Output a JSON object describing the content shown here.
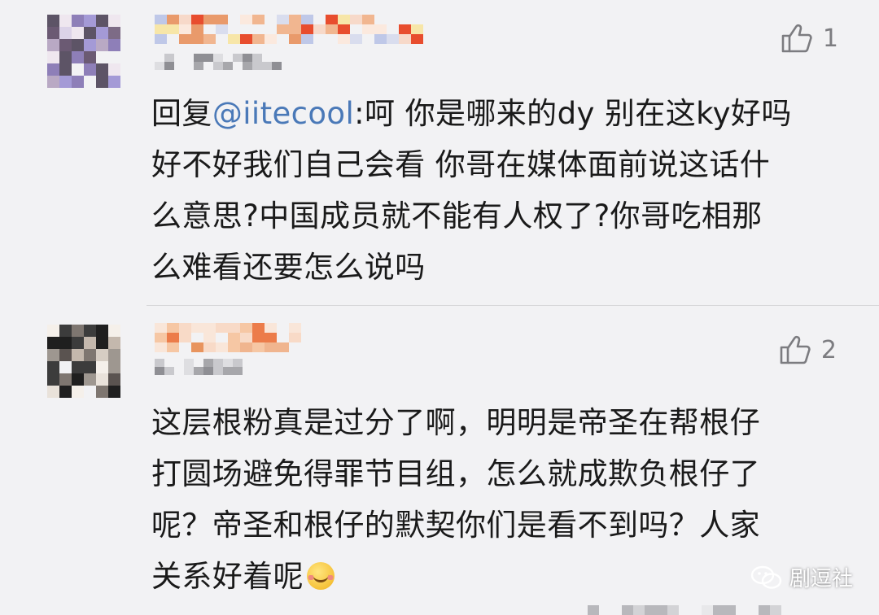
{
  "comments": [
    {
      "likes": "1",
      "mention": "@iitecool",
      "reply_prefix": "回复",
      "reply_rest": ":呵 你是哪来的dy 别在这ky好吗\n好不好我们自己会看 你哥在媒体面前说这话什\n么意思?中国成员就不能有人权了?你哥吃相那\n么难看还要怎么说吗"
    },
    {
      "likes": "2",
      "body": "这层根粉真是过分了啊，明明是帝圣在帮根仔\n打圆场避免得罪节目组，怎么就成欺负根仔了\n呢？帝圣和根仔的默契你们是看不到吗？人家\n关系好着呢",
      "emoji": "smiling-face-with-hands-icon"
    }
  ],
  "watermark": {
    "text": "剧逗社",
    "icon": "wechat-icon"
  },
  "colors": {
    "background": "#f2f2f4",
    "mention": "#4a79b8",
    "meta_gray": "#7c7c80"
  }
}
